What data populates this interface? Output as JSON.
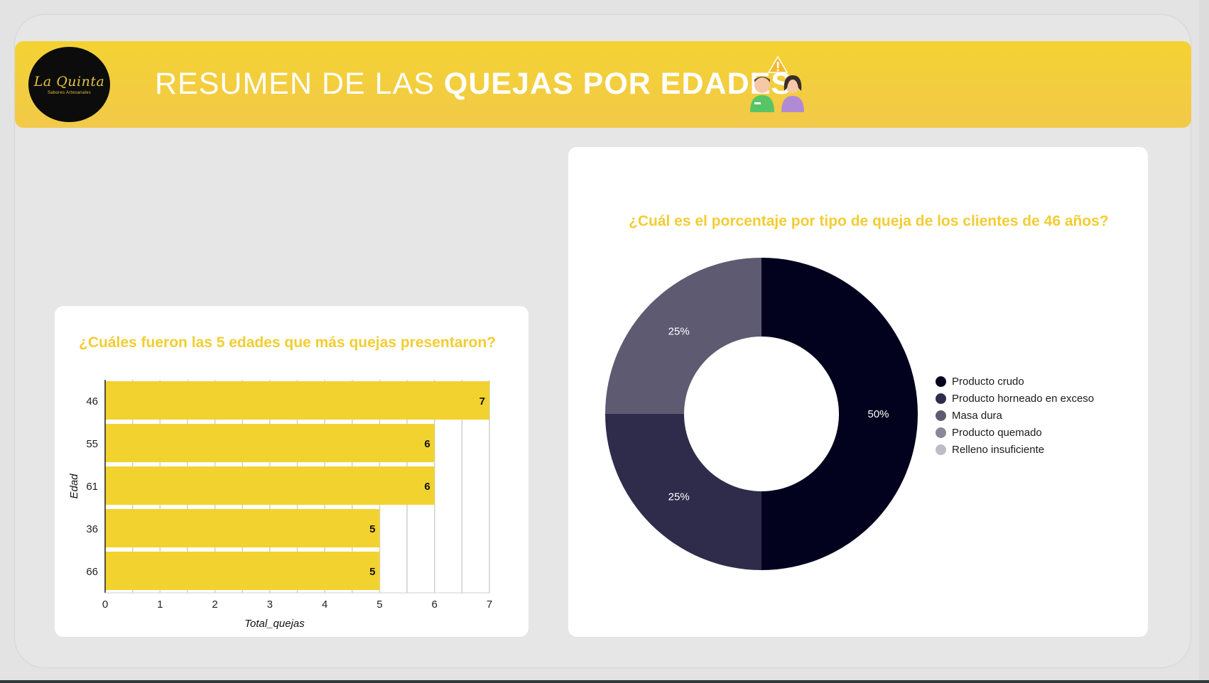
{
  "header": {
    "title_light": "RESUMEN DE LAS ",
    "title_bold": "QUEJAS POR EDADES",
    "logo_text": "La Quinta",
    "logo_tagline": "Sabores Artesanales"
  },
  "bar_card": {
    "title": "¿Cuáles fueron las 5 edades que más quejas presentaron?"
  },
  "pie_card": {
    "title": "¿Cuál es el porcentaje por tipo de queja de los clientes de 46 años?"
  },
  "chart_data": [
    {
      "type": "bar",
      "orientation": "horizontal",
      "title": "¿Cuáles fueron las 5 edades que más quejas presentaron?",
      "xlabel": "Total_quejas",
      "ylabel": "Edad",
      "categories": [
        "46",
        "55",
        "61",
        "36",
        "66"
      ],
      "values": [
        7,
        6,
        6,
        5,
        5
      ],
      "xlim": [
        0,
        7
      ],
      "xticks": [
        "0",
        "1",
        "2",
        "3",
        "4",
        "5",
        "6",
        "7"
      ],
      "grid": true,
      "bar_color": "#f2d22e",
      "data_labels": true
    },
    {
      "type": "pie",
      "donut": true,
      "title": "¿Cuál es el porcentaje por tipo de queja de los clientes de 46 años?",
      "labels": [
        "Producto crudo",
        "Producto horneado en exceso",
        "Masa dura",
        "Producto quemado",
        "Relleno insuficiente"
      ],
      "values": [
        50,
        25,
        25,
        0,
        0
      ],
      "value_labels": [
        "50%",
        "25%",
        "25%",
        "",
        ""
      ],
      "colors": [
        "#02021f",
        "#2f2c4b",
        "#5d5a72",
        "#8a8799",
        "#bdbcc6"
      ],
      "legend_position": "right"
    }
  ]
}
